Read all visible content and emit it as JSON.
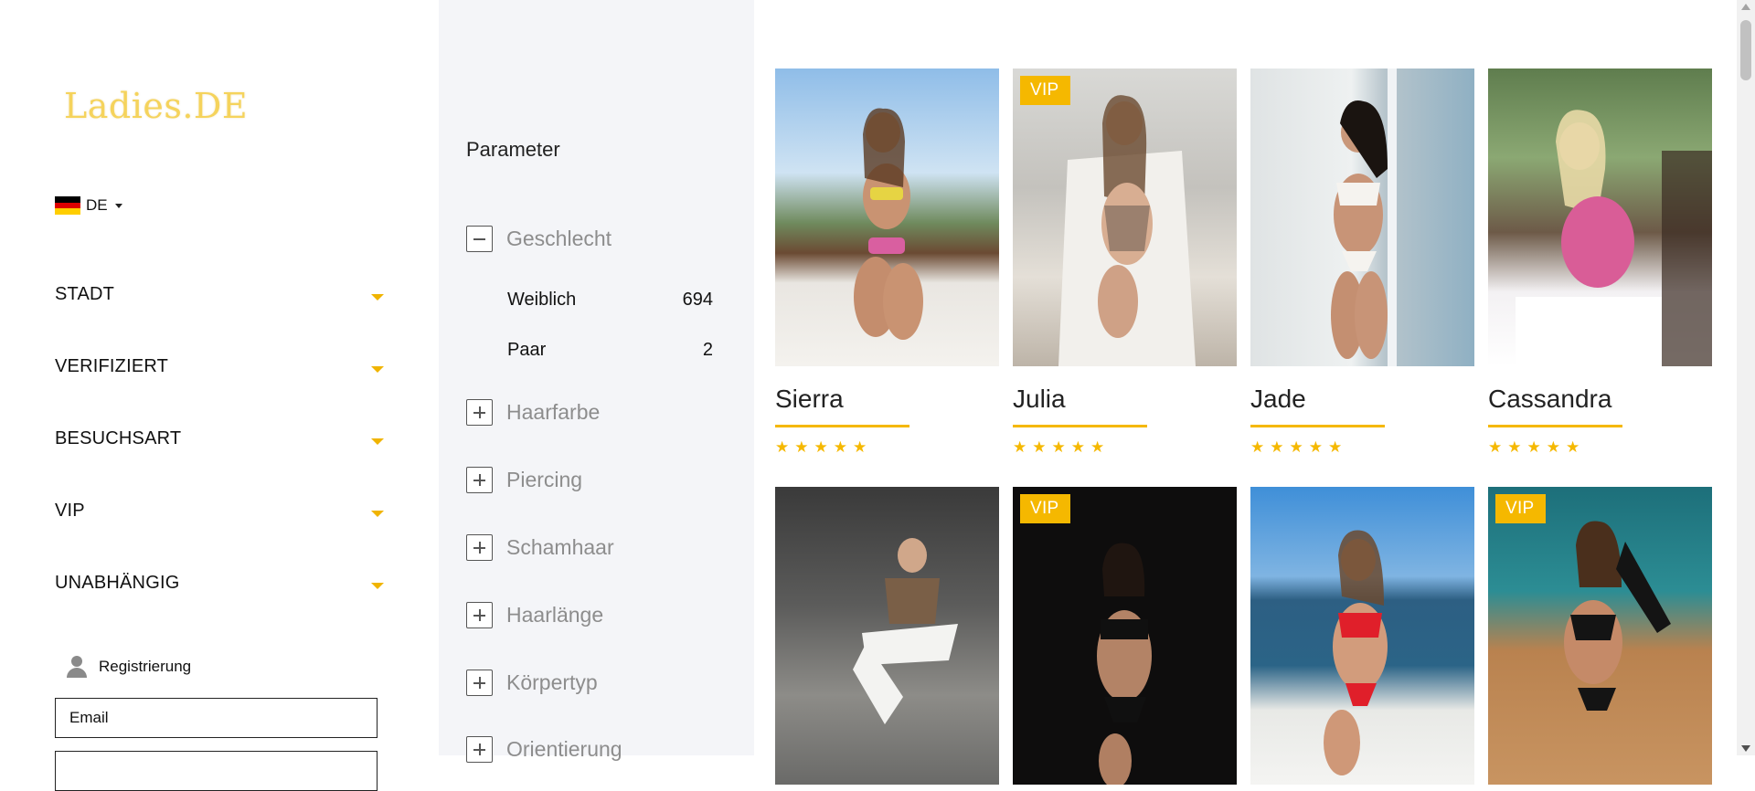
{
  "brand": {
    "logo_text": "Ladies.DE",
    "accent_color": "#f5b800"
  },
  "language": {
    "code": "DE",
    "flag_colors": [
      "#000000",
      "#dd0000",
      "#ffce00"
    ]
  },
  "filters": [
    {
      "label": "STADT"
    },
    {
      "label": "VERIFIZIERT"
    },
    {
      "label": "BESUCHSART"
    },
    {
      "label": "VIP"
    },
    {
      "label": "UNABHÄNGIG"
    }
  ],
  "account": {
    "register_label": "Registrierung",
    "email_placeholder": "Email"
  },
  "parameters": {
    "title": "Parameter",
    "groups": [
      {
        "label": "Geschlecht",
        "expanded": true,
        "options": [
          {
            "label": "Weiblich",
            "count": "694"
          },
          {
            "label": "Paar",
            "count": "2"
          }
        ]
      },
      {
        "label": "Haarfarbe",
        "expanded": false
      },
      {
        "label": "Piercing",
        "expanded": false
      },
      {
        "label": "Schamhaar",
        "expanded": false
      },
      {
        "label": "Haarlänge",
        "expanded": false
      },
      {
        "label": "Körpertyp",
        "expanded": false
      },
      {
        "label": "Orientierung",
        "expanded": false
      }
    ]
  },
  "profiles": [
    {
      "name": "Sierra",
      "vip": false,
      "rating": 5,
      "photo": "woman in floral bikini kneeling poolside"
    },
    {
      "name": "Julia",
      "vip": true,
      "vip_label": "VIP",
      "rating": 5,
      "photo": "tattooed woman in white coat"
    },
    {
      "name": "Jade",
      "vip": false,
      "rating": 5,
      "photo": "woman in white lingerie by window"
    },
    {
      "name": "Cassandra",
      "vip": false,
      "rating": 5,
      "photo": "blonde woman in pink dress on terrace"
    },
    {
      "name": "",
      "vip": false,
      "photo": "woman in white pants in parking garage"
    },
    {
      "name": "",
      "vip": true,
      "vip_label": "VIP",
      "photo": "woman in black bikini on dark background"
    },
    {
      "name": "",
      "vip": false,
      "photo": "woman in red bikini on boat"
    },
    {
      "name": "",
      "vip": true,
      "vip_label": "VIP",
      "photo": "woman in black swimsuit on boat"
    }
  ]
}
